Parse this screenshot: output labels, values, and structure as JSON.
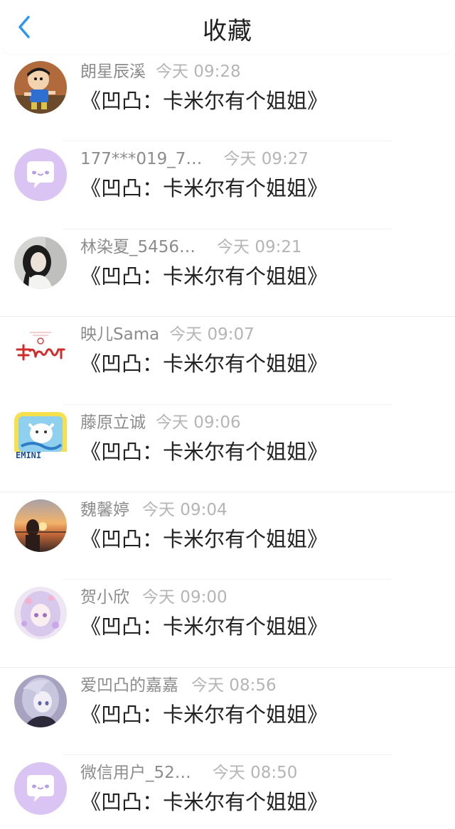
{
  "header": {
    "title": "收藏",
    "back_icon": "chevron-left-icon",
    "accent_color": "#2b97f3"
  },
  "items": [
    {
      "username": "朗星辰溪",
      "time": "今天 09:28",
      "title": "《凹凸：卡米尔有个姐姐》",
      "avatar": "cartoon-boy-avatar"
    },
    {
      "username": "177***019_7…",
      "time": "今天 09:27",
      "title": "《凹凸：卡米尔有个姐姐》",
      "avatar": "default-chat-avatar"
    },
    {
      "username": "林染夏_5456…",
      "time": "今天 09:21",
      "title": "《凹凸：卡米尔有个姐姐》",
      "avatar": "girl-photo-avatar"
    },
    {
      "username": "映儿Sama",
      "time": "今天 09:07",
      "title": "《凹凸：卡米尔有个姐姐》",
      "avatar": "handwriting-avatar"
    },
    {
      "username": "藤原立诚",
      "time": "今天 09:06",
      "title": "《凹凸：卡米尔有个姐姐》",
      "avatar": "gemini-cartoon-avatar",
      "avatar_text": "EMINI"
    },
    {
      "username": "魏馨婷",
      "time": "今天 09:04",
      "title": "《凹凸：卡米尔有个姐姐》",
      "avatar": "sunset-photo-avatar"
    },
    {
      "username": "贺小欣",
      "time": "今天 09:00",
      "title": "《凹凸：卡米尔有个姐姐》",
      "avatar": "anime-girl-avatar"
    },
    {
      "username": "爱凹凸的嘉嘉",
      "time": "今天 08:56",
      "title": "《凹凸：卡米尔有个姐姐》",
      "avatar": "anime-white-hair-avatar"
    },
    {
      "username": "微信用户_52…",
      "time": "今天 08:50",
      "title": "《凹凸：卡米尔有个姐姐》",
      "avatar": "default-chat-avatar"
    }
  ]
}
